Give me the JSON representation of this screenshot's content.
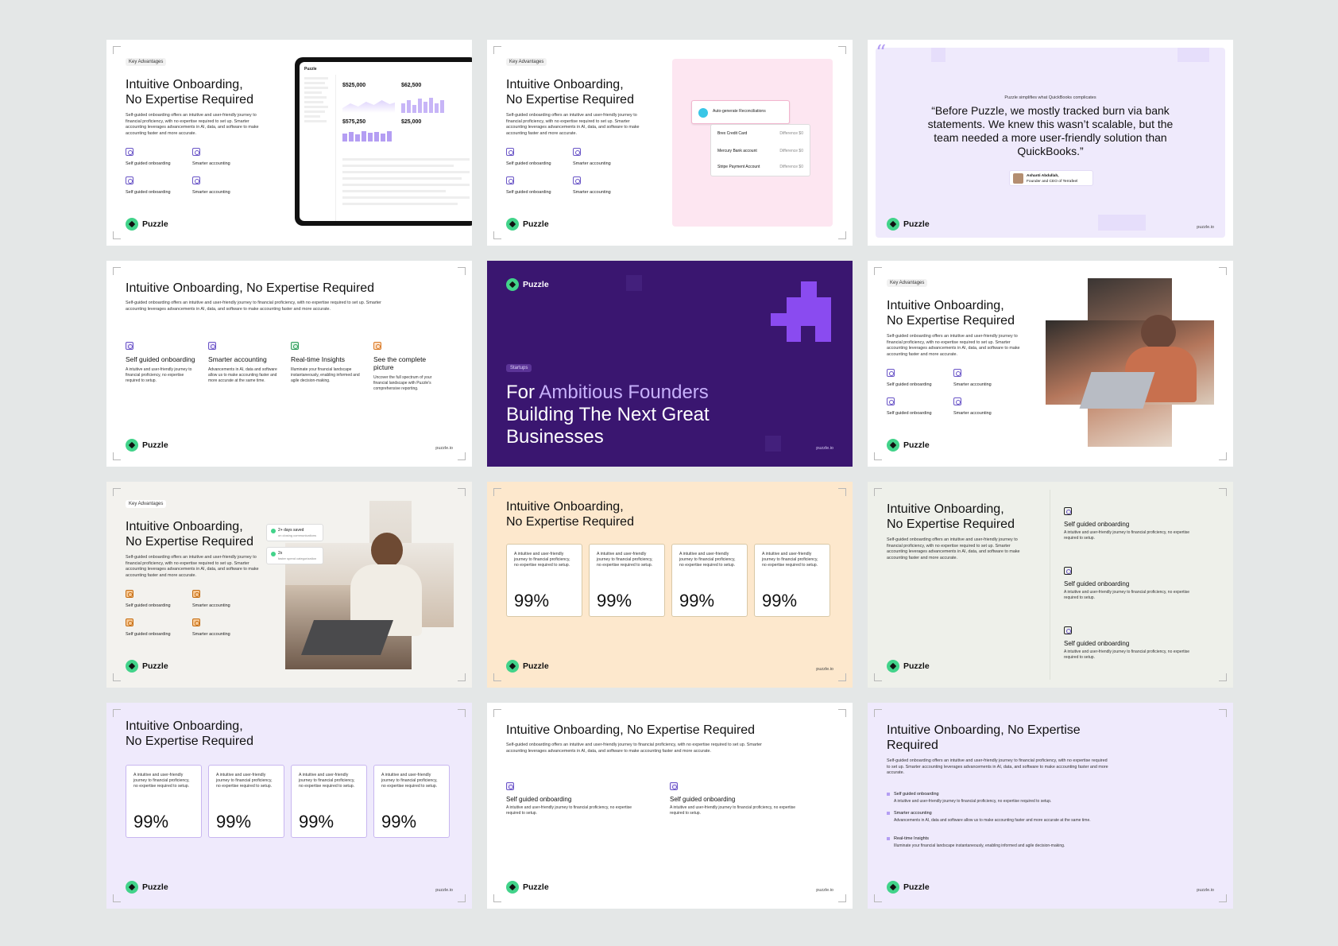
{
  "brand": {
    "name": "Puzzle",
    "url": "puzzle.io"
  },
  "common": {
    "key_advantages": "Key Advantages",
    "title_two_line_1": "Intuitive Onboarding,",
    "title_two_line_2": "No Expertise Required",
    "title_one_line": "Intuitive Onboarding, No Expertise Required",
    "body_long": "Self-guided onboarding offers an intuitive and user-friendly journey to financial proficiency, with no expertise required to set up. Smarter accounting leverages advancements in AI, data, and software to make accounting faster and more accurate.",
    "feature_self": "Self guided onboarding",
    "feature_smart": "Smarter accounting",
    "card_text": "A intuitive and user-friendly journey to financial proficiency, no expertise required to setup.",
    "card_value": "99%"
  },
  "slide1": {
    "dashboard": {
      "app": "Puzzle",
      "cash": "$525,000",
      "revenue": "$62,500",
      "spend": "$575,250",
      "burn": "$25,000"
    }
  },
  "slide2": {
    "task": "Auto-generate Reconciliations",
    "rows": [
      {
        "name": "Brex Credit Card",
        "tag": "Difference $0"
      },
      {
        "name": "Mercury Bank account",
        "tag": "Difference $0"
      },
      {
        "name": "Stripe Payment Account",
        "tag": "Difference $0"
      }
    ]
  },
  "slide3": {
    "kicker": "Puzzle simplifies what QuickBooks complicates",
    "quote": "“Before Puzzle, we mostly tracked burn via bank statements. We knew this wasn’t scalable, but the team needed a more user-friendly solution than QuickBooks.”",
    "author": "Ashanti Abdullah,",
    "role": "Founder and CEO of Terrafeel"
  },
  "slide4": {
    "body": "Self-guided onboarding offers an intuitive and user-friendly journey to financial proficiency, with no expertise required to set up. Smarter accounting leverages advancements in AI, data, and software to make accounting faster and more accurate.",
    "cols": [
      {
        "title": "Self guided onboarding",
        "text": "A intuitive and user-friendly journey to financial proficiency, no expertise required to setup."
      },
      {
        "title": "Smarter accounting",
        "text": "Advancements in AI, data and software allow us to make accounting faster and more accurate at the same time."
      },
      {
        "title": "Real-time Insights",
        "text": "Illuminate your financial landscape instantaneously, enabling informed and agile decision-making."
      },
      {
        "title": "See the complete picture",
        "text": "Uncover the full spectrum of your financial landscape with Puzzle's comprehensive reporting."
      }
    ]
  },
  "slide5": {
    "tag": "Startups",
    "line1_a": "For ",
    "line1_b": "Ambitious Founders",
    "line2": "Building The Next Great",
    "line3": "Businesses"
  },
  "slide7": {
    "stat1": "2+ days saved",
    "stat1_sub": "on closing communications",
    "stat2": "2x",
    "stat2_sub": "faster spend categorization"
  },
  "slide12": {
    "title_1": "Intuitive Onboarding, No Expertise",
    "title_2": "Required",
    "items": [
      {
        "title": "Self guided onboarding",
        "text": "A intuitive and user-friendly journey to financial proficiency, no expertise required to setup."
      },
      {
        "title": "Smarter accounting",
        "text": "Advancements in AI, data and software allow us to make accounting faster and more accurate at the same time."
      },
      {
        "title": "Real-time Insights",
        "text": "Illuminate your financial landscape instantaneously, enabling informed and agile decision-making."
      }
    ]
  },
  "colors": {
    "purple": "#3a1e73",
    "lavender": "#efeafc",
    "peach": "#fde8cd",
    "green": "#42d38a",
    "sage": "#eef0ea"
  }
}
